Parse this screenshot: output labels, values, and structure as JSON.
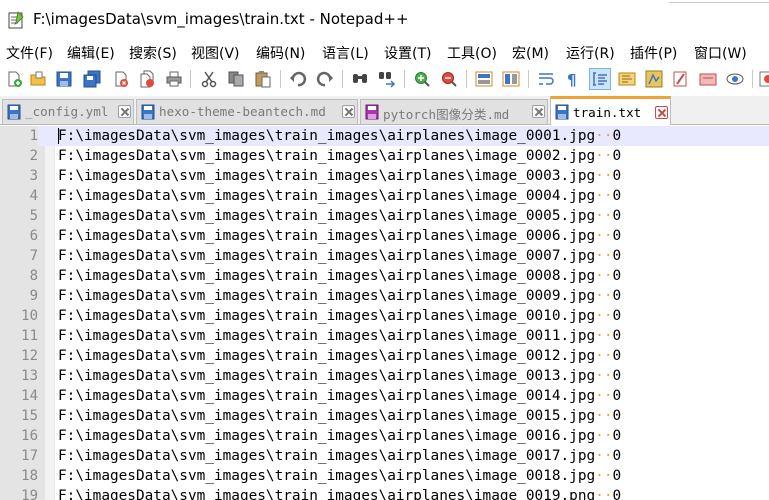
{
  "window": {
    "title": "F:\\imagesData\\svm_images\\train.txt - Notepad++"
  },
  "menu": [
    "文件(F)",
    "编辑(E)",
    "搜索(S)",
    "视图(V)",
    "编码(N)",
    "语言(L)",
    "设置(T)",
    "工具(O)",
    "宏(M)",
    "运行(R)",
    "插件(P)",
    "窗口(W)"
  ],
  "toolbar": {
    "buttons": [
      {
        "name": "new-file-icon"
      },
      {
        "name": "open-file-icon"
      },
      {
        "name": "save-icon"
      },
      {
        "name": "save-all-icon"
      },
      {
        "name": "close-icon"
      },
      {
        "name": "close-all-icon"
      },
      {
        "name": "print-icon"
      },
      {
        "name": "cut-icon"
      },
      {
        "name": "copy-icon"
      },
      {
        "name": "paste-icon"
      },
      {
        "name": "undo-icon"
      },
      {
        "name": "redo-icon"
      },
      {
        "name": "find-icon"
      },
      {
        "name": "replace-icon"
      },
      {
        "name": "zoom-in-icon"
      },
      {
        "name": "zoom-out-icon"
      },
      {
        "name": "sync-vertical-icon"
      },
      {
        "name": "sync-horizontal-icon"
      },
      {
        "name": "word-wrap-icon"
      },
      {
        "name": "show-all-chars-icon"
      },
      {
        "name": "indent-guide-icon"
      },
      {
        "name": "doc-map-icon"
      },
      {
        "name": "function-list-icon"
      },
      {
        "name": "folder-workspace-icon"
      },
      {
        "name": "monitoring-icon"
      },
      {
        "name": "eye-icon"
      },
      {
        "name": "record-macro-icon"
      }
    ],
    "active": "indent-guide-icon"
  },
  "tabs": [
    {
      "label": "_config.yml",
      "state": "saved",
      "active": false
    },
    {
      "label": "hexo-theme-beantech.md",
      "state": "saved",
      "active": false
    },
    {
      "label": "pytorch图像分类.md",
      "state": "modified",
      "active": false
    },
    {
      "label": "train.txt",
      "state": "saved",
      "active": true
    }
  ],
  "editor": {
    "current_line": 1,
    "lines": [
      {
        "n": "1",
        "path": "F:\\imagesData\\svm_images\\train_images\\airplanes\\image_0001.jpg",
        "sep": "··",
        "label": "0"
      },
      {
        "n": "2",
        "path": "F:\\imagesData\\svm_images\\train_images\\airplanes\\image_0002.jpg",
        "sep": "··",
        "label": "0"
      },
      {
        "n": "3",
        "path": "F:\\imagesData\\svm_images\\train_images\\airplanes\\image_0003.jpg",
        "sep": "··",
        "label": "0"
      },
      {
        "n": "4",
        "path": "F:\\imagesData\\svm_images\\train_images\\airplanes\\image_0004.jpg",
        "sep": "··",
        "label": "0"
      },
      {
        "n": "5",
        "path": "F:\\imagesData\\svm_images\\train_images\\airplanes\\image_0005.jpg",
        "sep": "··",
        "label": "0"
      },
      {
        "n": "6",
        "path": "F:\\imagesData\\svm_images\\train_images\\airplanes\\image_0006.jpg",
        "sep": "··",
        "label": "0"
      },
      {
        "n": "7",
        "path": "F:\\imagesData\\svm_images\\train_images\\airplanes\\image_0007.jpg",
        "sep": "··",
        "label": "0"
      },
      {
        "n": "8",
        "path": "F:\\imagesData\\svm_images\\train_images\\airplanes\\image_0008.jpg",
        "sep": "··",
        "label": "0"
      },
      {
        "n": "9",
        "path": "F:\\imagesData\\svm_images\\train_images\\airplanes\\image_0009.jpg",
        "sep": "··",
        "label": "0"
      },
      {
        "n": "10",
        "path": "F:\\imagesData\\svm_images\\train_images\\airplanes\\image_0010.jpg",
        "sep": "··",
        "label": "0"
      },
      {
        "n": "11",
        "path": "F:\\imagesData\\svm_images\\train_images\\airplanes\\image_0011.jpg",
        "sep": "··",
        "label": "0"
      },
      {
        "n": "12",
        "path": "F:\\imagesData\\svm_images\\train_images\\airplanes\\image_0012.jpg",
        "sep": "··",
        "label": "0"
      },
      {
        "n": "13",
        "path": "F:\\imagesData\\svm_images\\train_images\\airplanes\\image_0013.jpg",
        "sep": "··",
        "label": "0"
      },
      {
        "n": "14",
        "path": "F:\\imagesData\\svm_images\\train_images\\airplanes\\image_0014.jpg",
        "sep": "··",
        "label": "0"
      },
      {
        "n": "15",
        "path": "F:\\imagesData\\svm_images\\train_images\\airplanes\\image_0015.jpg",
        "sep": "··",
        "label": "0"
      },
      {
        "n": "16",
        "path": "F:\\imagesData\\svm_images\\train_images\\airplanes\\image_0016.jpg",
        "sep": "··",
        "label": "0"
      },
      {
        "n": "17",
        "path": "F:\\imagesData\\svm_images\\train_images\\airplanes\\image_0017.jpg",
        "sep": "··",
        "label": "0"
      },
      {
        "n": "18",
        "path": "F:\\imagesData\\svm_images\\train_images\\airplanes\\image_0018.jpg",
        "sep": "··",
        "label": "0"
      },
      {
        "n": "19",
        "path": "F:\\imagesData\\svm_images\\train_images\\airplanes\\image_0019.png",
        "sep": "··",
        "label": "0"
      }
    ]
  },
  "colors": {
    "accent_tab": "#f0a233",
    "current_line": "#e8e8ff",
    "gutter": "#e4e4e4",
    "whitespace_marker": "#f0a233"
  }
}
